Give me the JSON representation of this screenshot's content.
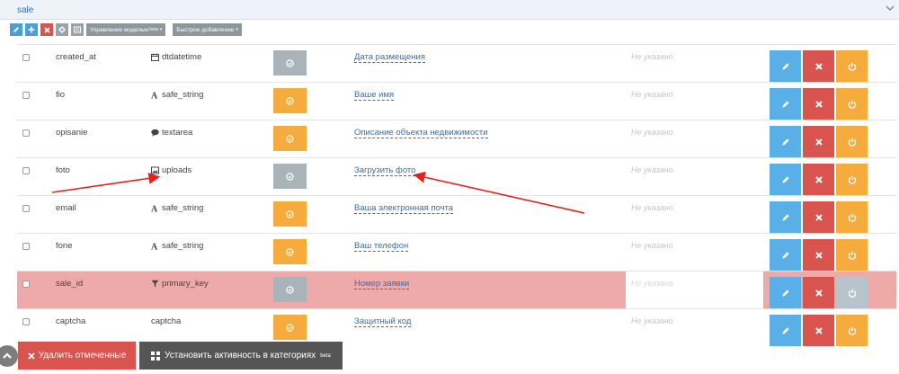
{
  "panel": {
    "title": "sale"
  },
  "toolbar": {
    "model_menu": "Управление моделью",
    "model_menu_sup": "beta",
    "quick_add": "Быстрое добавление"
  },
  "rows": [
    {
      "name": "created_at",
      "type": "dtdatetime",
      "type_icon": "calendar-icon",
      "status": "gray",
      "label": "Дата размещения",
      "default": "Не указано",
      "power": "on"
    },
    {
      "name": "fio",
      "type": "safe_string",
      "type_icon": "font-icon",
      "status": "orange",
      "label": "Ваше имя",
      "default": "Не указано",
      "power": "on"
    },
    {
      "name": "opisanie",
      "type": "textarea",
      "type_icon": "comment-icon",
      "status": "orange",
      "label": "Описание объекта недвижимости",
      "default": "Не указано",
      "power": "on"
    },
    {
      "name": "foto",
      "type": "uploads",
      "type_icon": "image-icon",
      "status": "gray",
      "label": "Загрузить фото",
      "default": "Не указано",
      "power": "on"
    },
    {
      "name": "email",
      "type": "safe_string",
      "type_icon": "font-icon",
      "status": "orange",
      "label": "Ваша электронная почта",
      "default": "Не указано",
      "power": "on"
    },
    {
      "name": "fone",
      "type": "safe_string",
      "type_icon": "font-icon",
      "status": "orange",
      "label": "Ваш телефон",
      "default": "Не указано",
      "power": "on"
    },
    {
      "name": "sale_id",
      "type": "primary_key",
      "type_icon": "filter-icon",
      "status": "gray",
      "label": "Номер заявки",
      "default": "Не указано",
      "power": "off",
      "highlighted": true
    },
    {
      "name": "captcha",
      "type": "captcha",
      "type_icon": "",
      "status": "orange",
      "label": "Защитный код",
      "default": "Не указано",
      "power": "on"
    }
  ],
  "bottom": {
    "delete_selected": "Удалить отмеченные",
    "set_activity": "Установить активность в категориях",
    "set_activity_sup": "beta"
  },
  "colors": {
    "blue": "#5aafe6",
    "red": "#d9534f",
    "orange": "#f5ac3d",
    "gray": "#a9b3ba",
    "highlight": "#eeaaa9",
    "annotation_arrow": "#e8201c"
  }
}
